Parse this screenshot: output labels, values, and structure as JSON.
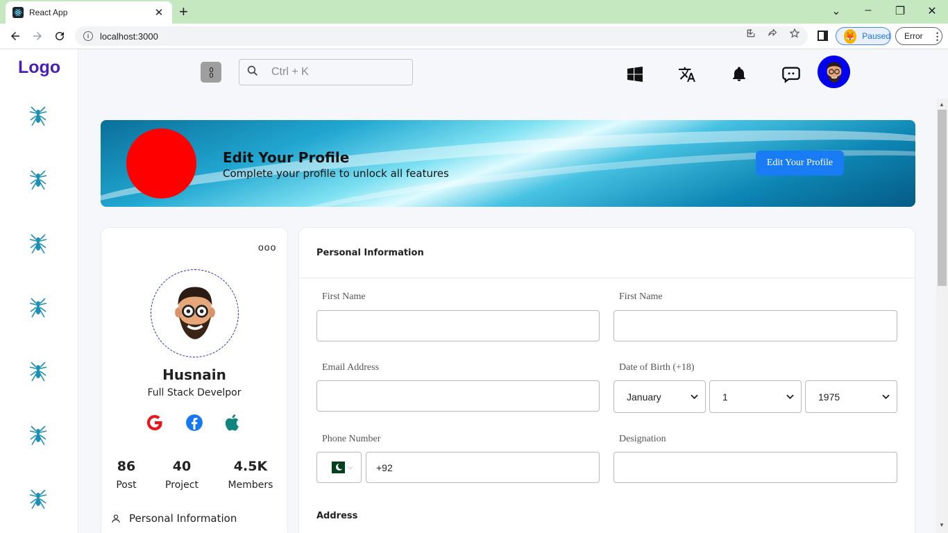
{
  "browser": {
    "tab_title": "React App",
    "tab_close": "✕",
    "new_tab": "+",
    "url": "localhost:3000",
    "profile_status": "Paused",
    "error_label": "Error",
    "error_menu": "⋮",
    "win_min": "–",
    "win_restore": "❐",
    "win_close": "✕",
    "win_chevron": "⌄"
  },
  "sidebar": {
    "logo": "Logo",
    "item_count": 7
  },
  "topbar": {
    "search_placeholder": "Ctrl + K",
    "icons": [
      "windows-icon",
      "translate-icon",
      "bell-icon",
      "chat-icon"
    ]
  },
  "banner": {
    "title": "Edit Your Profile",
    "subtitle": "Complete your profile to unlock all features",
    "button_label": "Edit Your Profile",
    "circle_color": "#ff0000"
  },
  "profile": {
    "name": "Husnain",
    "role": "Full Stack Develpor",
    "more": "ooo",
    "stats": [
      {
        "value": "86",
        "label": "Post"
      },
      {
        "value": "40",
        "label": "Project"
      },
      {
        "value": "4.5K",
        "label": "Members"
      }
    ],
    "menu_item": "Personal Information"
  },
  "form": {
    "title": "Personal Information",
    "first_name_label": "First Name",
    "first_name_2_label": "First Name",
    "email_label": "Email Address",
    "dob_label": "Date of Birth (+18)",
    "dob_month": "January",
    "dob_day": "1",
    "dob_year": "1975",
    "phone_label": "Phone Number",
    "phone_value": "+92",
    "designation_label": "Designation",
    "address_label": "Address"
  },
  "colors": {
    "accent": "#1a7cf5",
    "logo": "#4a1fb8",
    "tabbar": "#c6e8c1"
  }
}
